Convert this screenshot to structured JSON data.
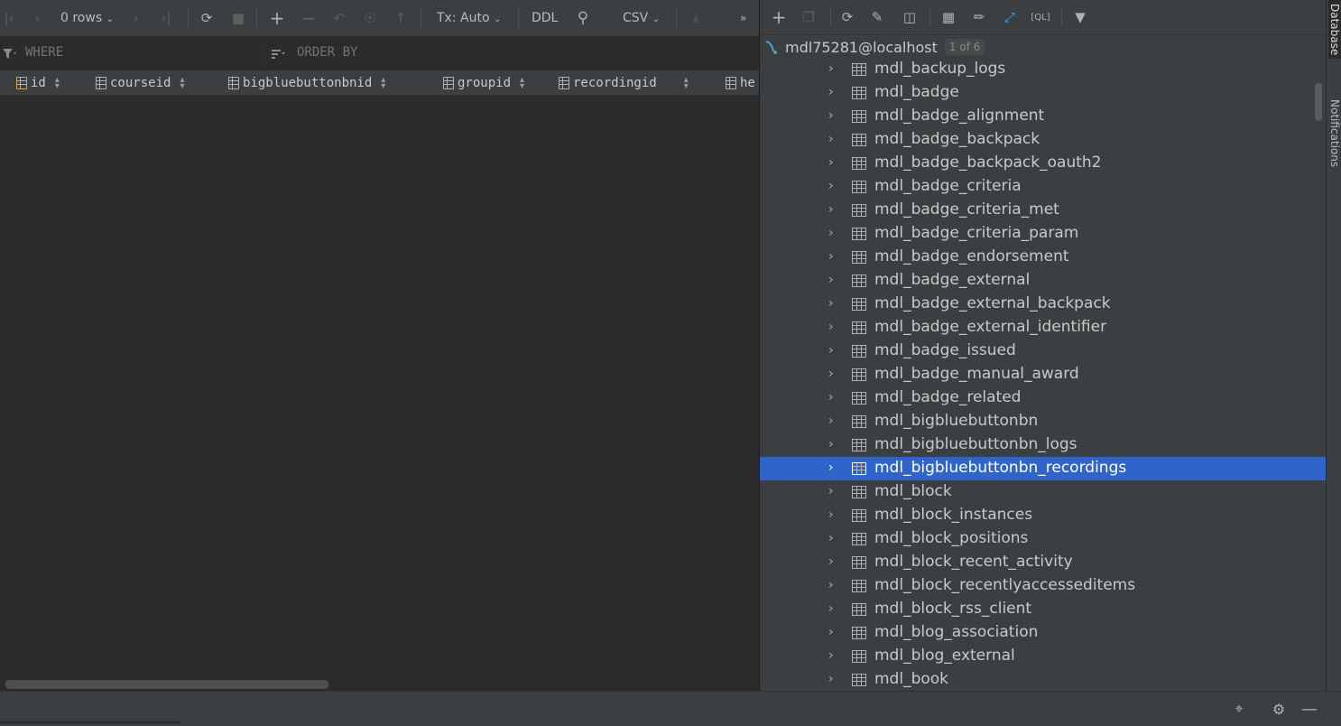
{
  "result_toolbar": {
    "rows_label": "0 rows",
    "tx_label": "Tx: Auto",
    "ddl_label": "DDL",
    "csv_label": "CSV",
    "more_label": "»"
  },
  "filter": {
    "where_placeholder": "WHERE",
    "orderby_placeholder": "ORDER BY"
  },
  "columns": [
    {
      "label": "id",
      "icon": "primary-key-column-icon"
    },
    {
      "label": "courseid",
      "icon": "column-icon"
    },
    {
      "label": "bigbluebuttonbnid",
      "icon": "indexed-column-icon"
    },
    {
      "label": "groupid",
      "icon": "column-icon"
    },
    {
      "label": "recordingid",
      "icon": "indexed-column-icon"
    },
    {
      "label": "he",
      "icon": "column-icon"
    }
  ],
  "database": {
    "root_label": "mdl75281@localhost",
    "root_badge": "1 of 6",
    "selected_table": "mdl_bigbluebuttonbn_recordings",
    "tables": [
      "mdl_backup_logs",
      "mdl_badge",
      "mdl_badge_alignment",
      "mdl_badge_backpack",
      "mdl_badge_backpack_oauth2",
      "mdl_badge_criteria",
      "mdl_badge_criteria_met",
      "mdl_badge_criteria_param",
      "mdl_badge_endorsement",
      "mdl_badge_external",
      "mdl_badge_external_backpack",
      "mdl_badge_external_identifier",
      "mdl_badge_issued",
      "mdl_badge_manual_award",
      "mdl_badge_related",
      "mdl_bigbluebuttonbn",
      "mdl_bigbluebuttonbn_logs",
      "mdl_bigbluebuttonbn_recordings",
      "mdl_block",
      "mdl_block_instances",
      "mdl_block_positions",
      "mdl_block_recent_activity",
      "mdl_block_recentlyaccesseditems",
      "mdl_block_rss_client",
      "mdl_blog_association",
      "mdl_blog_external",
      "mdl_book"
    ]
  },
  "side_tabs": {
    "database": "Database",
    "notifications": "Notifications"
  },
  "colors": {
    "background": "#2b2b2b",
    "panel": "#3c3f41",
    "selection": "#2f65ca",
    "text": "#bbbbbb"
  }
}
